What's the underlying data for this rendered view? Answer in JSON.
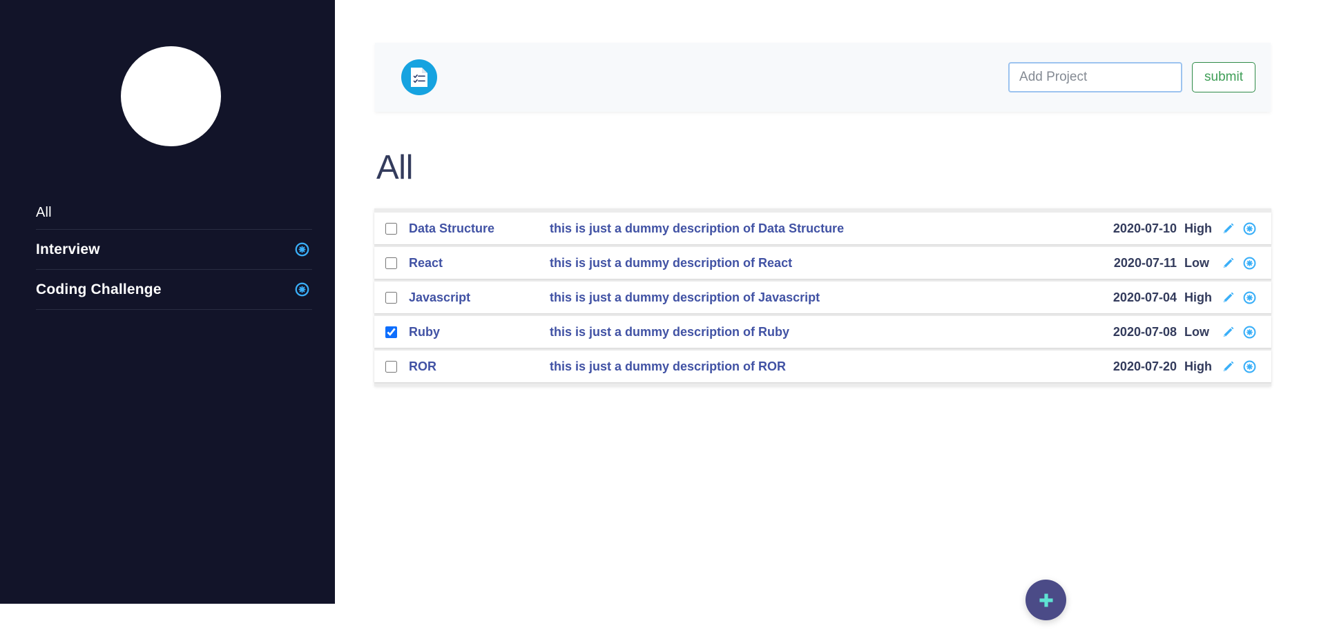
{
  "sidebar": {
    "avatar_name": "user-avatar",
    "items": [
      {
        "label": "All",
        "deletable": false
      },
      {
        "label": "Interview",
        "deletable": true
      },
      {
        "label": "Coding Challenge",
        "deletable": true
      }
    ]
  },
  "header": {
    "logo_icon": "document-checklist-icon",
    "input": {
      "placeholder": "Add Project",
      "value": ""
    },
    "submit_label": "submit"
  },
  "main": {
    "page_title": "All",
    "tasks": [
      {
        "name": "Data Structure",
        "description": "this is just a dummy description of Data Structure",
        "date": "2020-07-10",
        "priority": "High",
        "checked": false
      },
      {
        "name": "React",
        "description": "this is just a dummy description of React",
        "date": "2020-07-11",
        "priority": "Low",
        "checked": false
      },
      {
        "name": "Javascript",
        "description": "this is just a dummy description of Javascript",
        "date": "2020-07-04",
        "priority": "High",
        "checked": false
      },
      {
        "name": "Ruby",
        "description": "this is just a dummy description of Ruby",
        "date": "2020-07-08",
        "priority": "Low",
        "checked": true
      },
      {
        "name": "ROR",
        "description": "this is just a dummy description of ROR",
        "date": "2020-07-20",
        "priority": "High",
        "checked": false
      }
    ]
  },
  "fab": {
    "icon": "plus-icon",
    "label": "add"
  },
  "colors": {
    "sidebar_bg": "#121429",
    "accent_blue": "#3aaff8",
    "logo_blue": "#16a3e0",
    "title_navy": "#333b5c",
    "task_text": "#4152a4",
    "submit_green": "#3f9e57",
    "input_border": "#9cc3ef",
    "fab_bg": "#4b4b87",
    "fab_plus": "#5fe3d3",
    "checkbox_checked": "#0d6efd"
  }
}
